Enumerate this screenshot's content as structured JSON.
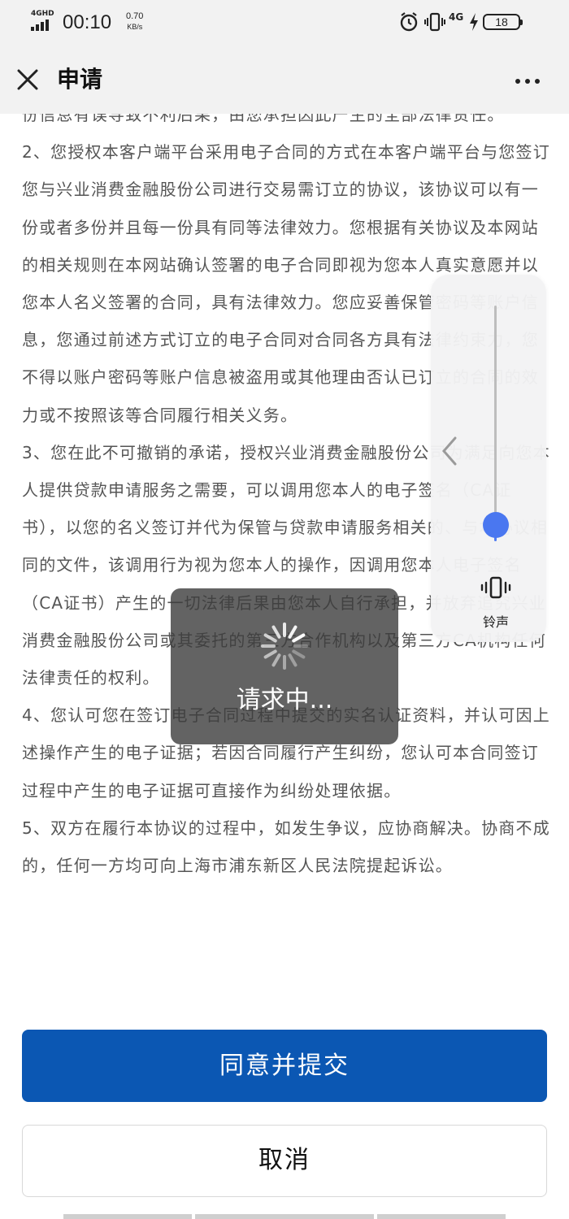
{
  "status_bar": {
    "network_type": "4GHD",
    "time": "00:10",
    "speed_value": "0.70",
    "speed_unit": "KB/s",
    "signal_4g": "4G",
    "battery_level": "18"
  },
  "header": {
    "title": "申请"
  },
  "agreement": {
    "paragraphs": [
      "份信息有误导致不利后果，由您承担因此产生的全部法律责任。",
      "2、您授权本客户端平台采用电子合同的方式在本客户端平台与您签订您与兴业消费金融股份公司进行交易需订立的协议，该协议可以有一份或者多份并且每一份具有同等法律效力。您根据有关协议及本网站的相关规则在本网站确认签署的电子合同即视为您本人真实意愿并以您本人名义签署的合同，具有法律效力。您应妥善保管密码等账户信息，您通过前述方式订立的电子合同对合同各方具有法律约束力，您不得以账户密码等账户信息被盗用或其他理由否认已订立的合同的效力或不按照该等合同履行相关义务。",
      "3、您在此不可撤销的承诺，授权兴业消费金融股份公司为满足向您本人提供贷款申请服务之需要，可以调用您本人的电子签名（CA证书），以您的名义签订并代为保管与贷款申请服务相关的、与本协议相同的文件，该调用行为视为您本人的操作，因调用您本人电子签名（CA证书）产生的一切法律后果由您本人自行承担，并放弃追究兴业消费金融股份公司或其委托的第三方合作机构以及第三方CA机构任何法律责任的权利。",
      "4、您认可您在签订电子合同过程中提交的实名认证资料，并认可因上述操作产生的电子证据；若因合同履行产生纠纷，您认可本合同签订过程中产生的电子证据可直接作为纠纷处理依据。",
      "5、双方在履行本协议的过程中，如发生争议，应协商解决。协商不成的，任何一方均可向上海市浦东新区人民法院提起诉讼。"
    ]
  },
  "volume_panel": {
    "level": 0.07,
    "mode_label": "铃声",
    "accent_color": "#4a77f0"
  },
  "loading": {
    "text": "请求中..."
  },
  "actions": {
    "agree_label": "同意并提交",
    "cancel_label": "取消",
    "primary_color": "#0b57b3"
  }
}
